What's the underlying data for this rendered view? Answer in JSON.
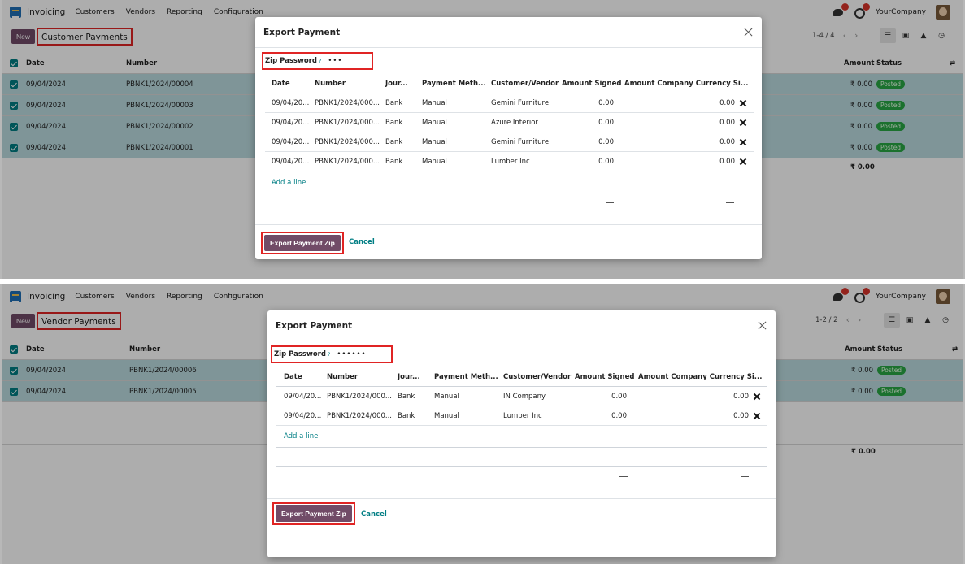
{
  "navbar": {
    "app_name": "Invoicing",
    "menu": [
      "Customers",
      "Vendors",
      "Reporting",
      "Configuration"
    ],
    "company": "YourCompany"
  },
  "customer_view": {
    "new_label": "New",
    "breadcrumb": "Customer Payments",
    "pager": "1-4 / 4",
    "list_headers": {
      "date": "Date",
      "number": "Number",
      "amount": "Amount",
      "status": "Status"
    },
    "rows": [
      {
        "date": "09/04/2024",
        "number": "PBNK1/2024/00004",
        "amount": "₹ 0.00",
        "status": "Posted"
      },
      {
        "date": "09/04/2024",
        "number": "PBNK1/2024/00003",
        "amount": "₹ 0.00",
        "status": "Posted"
      },
      {
        "date": "09/04/2024",
        "number": "PBNK1/2024/00002",
        "amount": "₹ 0.00",
        "status": "Posted"
      },
      {
        "date": "09/04/2024",
        "number": "PBNK1/2024/00001",
        "amount": "₹ 0.00",
        "status": "Posted"
      }
    ],
    "total": "₹ 0.00",
    "modal": {
      "title": "Export Payment",
      "zip_label": "Zip Password",
      "zip_help": "?",
      "zip_value": "•••",
      "headers": [
        "Date",
        "Number",
        "Jour...",
        "Payment Meth...",
        "Customer/Vendor",
        "Amount Signed",
        "Amount Company Currency Si..."
      ],
      "rows": [
        {
          "date": "09/04/20...",
          "number": "PBNK1/2024/000...",
          "journal": "Bank",
          "method": "Manual",
          "partner": "Gemini Furniture",
          "signed": "0.00",
          "company": "0.00"
        },
        {
          "date": "09/04/20...",
          "number": "PBNK1/2024/000...",
          "journal": "Bank",
          "method": "Manual",
          "partner": "Azure Interior",
          "signed": "0.00",
          "company": "0.00"
        },
        {
          "date": "09/04/20...",
          "number": "PBNK1/2024/000...",
          "journal": "Bank",
          "method": "Manual",
          "partner": "Gemini Furniture",
          "signed": "0.00",
          "company": "0.00"
        },
        {
          "date": "09/04/20...",
          "number": "PBNK1/2024/000...",
          "journal": "Bank",
          "method": "Manual",
          "partner": "Lumber Inc",
          "signed": "0.00",
          "company": "0.00"
        }
      ],
      "add_line": "Add a line",
      "sum_signed": "—",
      "sum_company": "—",
      "export_label": "Export Payment Zip",
      "cancel_label": "Cancel"
    }
  },
  "vendor_view": {
    "new_label": "New",
    "breadcrumb": "Vendor Payments",
    "pager": "1-2 / 2",
    "list_headers": {
      "date": "Date",
      "number": "Number",
      "amount": "Amount",
      "status": "Status"
    },
    "rows": [
      {
        "date": "09/04/2024",
        "number": "PBNK1/2024/00006",
        "amount": "₹ 0.00",
        "status": "Posted"
      },
      {
        "date": "09/04/2024",
        "number": "PBNK1/2024/00005",
        "amount": "₹ 0.00",
        "status": "Posted"
      }
    ],
    "total": "₹ 0.00",
    "modal": {
      "title": "Export Payment",
      "zip_label": "Zip Password",
      "zip_help": "?",
      "zip_value": "••••••",
      "headers": [
        "Date",
        "Number",
        "Jour...",
        "Payment Meth...",
        "Customer/Vendor",
        "Amount Signed",
        "Amount Company Currency Si..."
      ],
      "rows": [
        {
          "date": "09/04/20...",
          "number": "PBNK1/2024/000...",
          "journal": "Bank",
          "method": "Manual",
          "partner": "IN Company",
          "signed": "0.00",
          "company": "0.00"
        },
        {
          "date": "09/04/20...",
          "number": "PBNK1/2024/000...",
          "journal": "Bank",
          "method": "Manual",
          "partner": "Lumber Inc",
          "signed": "0.00",
          "company": "0.00"
        }
      ],
      "add_line": "Add a line",
      "sum_signed": "—",
      "sum_company": "—",
      "export_label": "Export Payment Zip",
      "cancel_label": "Cancel"
    }
  }
}
